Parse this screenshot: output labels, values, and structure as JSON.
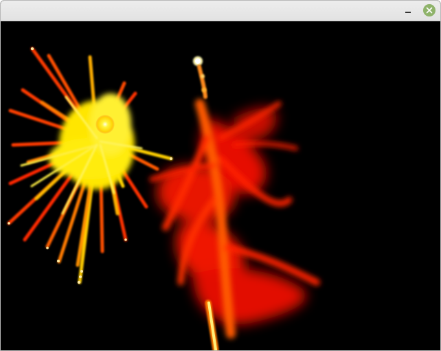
{
  "window": {
    "title": "",
    "controls": {
      "minimize_icon": "minimize-icon",
      "close_icon": "close-icon",
      "close_color": "#8fb36a"
    }
  },
  "scene": {
    "background": "#000000",
    "bursts": [
      {
        "name": "yellow-burst",
        "core_color": "#fff23a",
        "outer_color": "#ff2a00"
      },
      {
        "name": "red-burst",
        "core_color": "#ff4a00",
        "outer_color": "#cc0000"
      }
    ]
  }
}
